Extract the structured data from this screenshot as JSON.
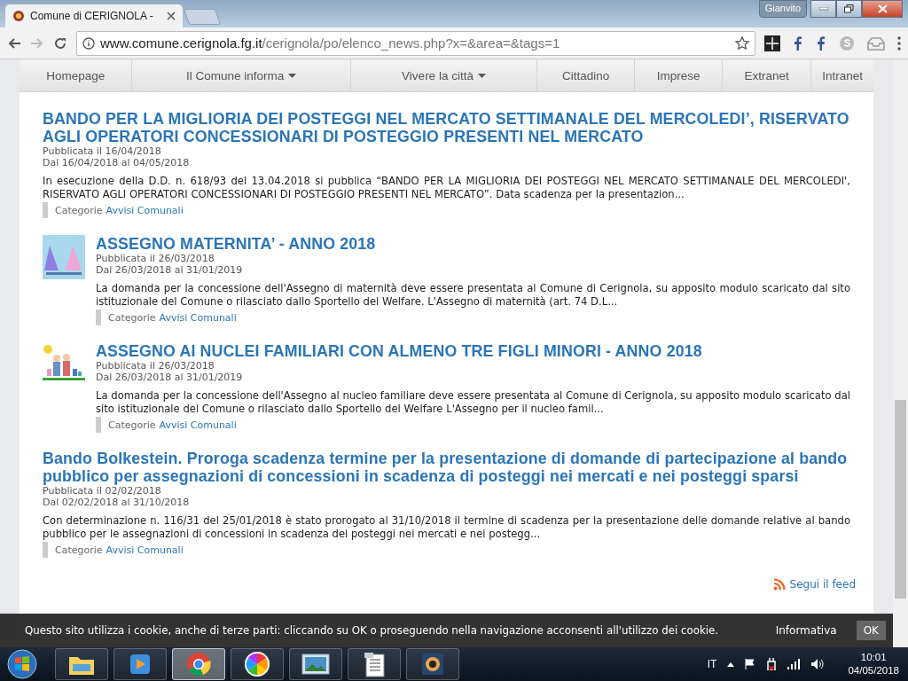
{
  "browser": {
    "tab_title": "Comune di CERIGNOLA -",
    "user": "Gianvito",
    "url_host": "www.comune.cerignola.fg.it",
    "url_path": "/cerignola/po/elenco_news.php?x=&area=&tags=1"
  },
  "nav": [
    {
      "label": "Homepage",
      "dropdown": false
    },
    {
      "label": "Il Comune informa",
      "dropdown": true
    },
    {
      "label": "Vivere la città",
      "dropdown": true
    },
    {
      "label": "Cittadino",
      "dropdown": false
    },
    {
      "label": "Imprese",
      "dropdown": false
    },
    {
      "label": "Extranet",
      "dropdown": false
    },
    {
      "label": "Intranet",
      "dropdown": false
    }
  ],
  "news": [
    {
      "kind": "plain",
      "title": "BANDO PER LA MIGLIORIA DEI POSTEGGI NEL MERCATO SETTIMANALE DEL MERCOLEDI’, RISERVATO AGLI OPERATORI CONCESSIONARI DI POSTEGGIO PRESENTI NEL MERCATO",
      "published": "Pubblicata il 16/04/2018",
      "range": "Dal 16/04/2018 al 04/05/2018",
      "summary": "In esecuzione della D.D. n. 618/93 del 13.04.2018 si pubblica “BANDO PER LA MIGLIORIA DEI POSTEGGI NEL MERCATO SETTIMANALE DEL MERCOLEDI', RISERVATO AGLI OPERATORI CONCESSIONARI DI POSTEGGIO PRESENTI NEL MERCATO”. Data scadenza per la presentazion...",
      "category_label": "Categorie",
      "category": "Avvisi Comunali"
    },
    {
      "kind": "maternity",
      "title": "ASSEGNO MATERNITA’ - ANNO 2018",
      "published": "Pubblicata il 26/03/2018",
      "range": "Dal 26/03/2018 al 31/01/2019",
      "summary": "La domanda per la concessione dell'Assegno di maternità deve essere presentata al Comune di Cerignola, su apposito modulo scaricato dal sito istituzionale del Comune o rilasciato dallo Sportello del Welfare. L'Assegno di maternità (art. 74 D.L...",
      "category_label": "Categorie",
      "category": "Avvisi Comunali"
    },
    {
      "kind": "family",
      "title": "ASSEGNO AI NUCLEI FAMILIARI CON ALMENO TRE FIGLI MINORI - ANNO 2018",
      "published": "Pubblicata il 26/03/2018",
      "range": "Dal 26/03/2018 al 31/01/2019",
      "summary": "La domanda per la concessione dell'Assegno al nucleo familiare deve essere presentata al Comune di Cerignola, su apposito modulo scaricato dal sito istituzionale del Comune o rilasciato dallo Sportello del Welfare L'Assegno per il nucleo famil...",
      "category_label": "Categorie",
      "category": "Avvisi Comunali"
    },
    {
      "kind": "plain",
      "title": "Bando Bolkestein. Proroga scadenza termine per la presentazione di domande di partecipazione al bando pubblico per assegnazioni di concessioni in scadenza di posteggi nei mercati e nei posteggi sparsi",
      "published": "Pubblicata il 02/02/2018",
      "range": "Dal 02/02/2018 al 31/10/2018",
      "summary": "Con determinazione n. 116/31 del 25/01/2018 è stato prorogato al 31/10/2018 il termine di  scadenza per la presentazione delle domande relative al bando pubblico per le assegnazioni di concessioni in scadenza dei posteggi nei mercati e nei postegg...",
      "category_label": "Categorie",
      "category": "Avvisi Comunali"
    }
  ],
  "feed_link": "Segui il feed",
  "cookie_bar": {
    "message": "Questo sito utilizza i cookie, anche di terze parti: cliccando su OK o proseguendo nella navigazione acconsenti all'utilizzo dei cookie.",
    "info_link": "Informativa",
    "ok": "OK"
  },
  "taskbar": {
    "apps": [
      {
        "kind": "folder",
        "active": false
      },
      {
        "kind": "media",
        "active": false
      },
      {
        "kind": "chrome",
        "active": true
      },
      {
        "kind": "photos",
        "active": false
      },
      {
        "kind": "picture",
        "active": false
      },
      {
        "kind": "document",
        "active": false
      },
      {
        "kind": "viewer",
        "active": false
      }
    ],
    "language": "IT",
    "time": "10:01",
    "date": "04/05/2018"
  }
}
